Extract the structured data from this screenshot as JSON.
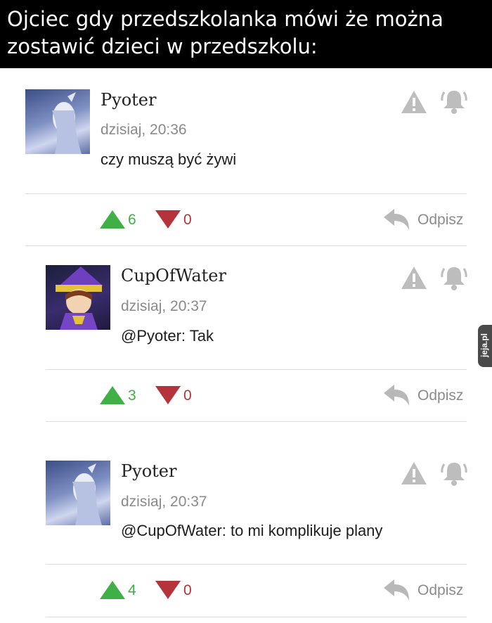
{
  "meme": {
    "caption_line1": "Ojciec gdy przedszkolanka mówi że można",
    "caption_line2": "zostawić dzieci w przedszkolu:"
  },
  "comments": [
    {
      "username": "Pyoter",
      "time": "dzisiaj, 20:36",
      "text": "czy muszą być żywi",
      "upvotes": "6",
      "downvotes": "0",
      "reply_label": "Odpisz"
    },
    {
      "username": "CupOfWater",
      "time": "dzisiaj, 20:37",
      "text": "@Pyoter: Tak",
      "upvotes": "3",
      "downvotes": "0",
      "reply_label": "Odpisz"
    },
    {
      "username": "Pyoter",
      "time": "dzisiaj, 20:37",
      "text": "@CupOfWater: to mi komplikuje plany",
      "upvotes": "4",
      "downvotes": "0",
      "reply_label": "Odpisz"
    }
  ],
  "watermark": "jeja.pl",
  "icons": {
    "report": "warning-icon",
    "notify": "bell-icon",
    "upvote": "triangle-up-icon",
    "downvote": "triangle-down-icon",
    "reply": "reply-arrow-icon"
  },
  "colors": {
    "upvote": "#3fb046",
    "downvote": "#b5333b",
    "icon_gray": "#bdbdbd"
  }
}
